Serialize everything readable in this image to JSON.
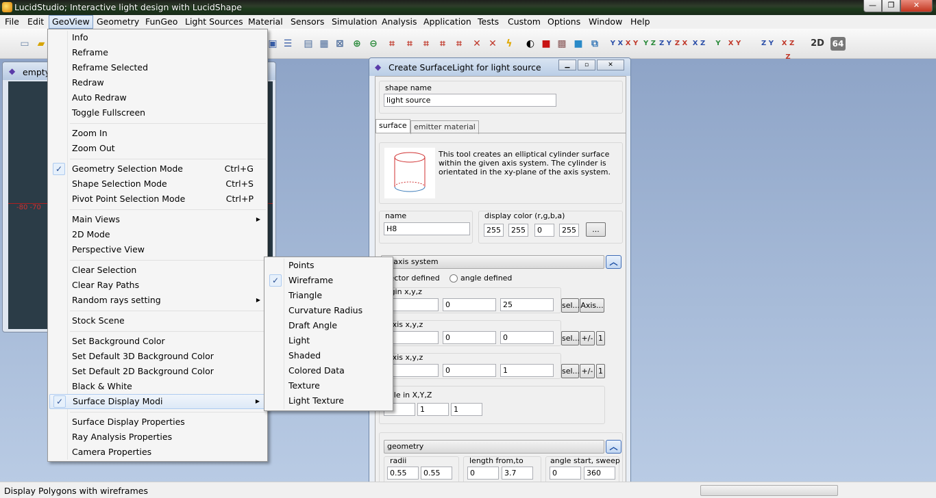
{
  "window": {
    "title": "LucidStudio; Interactive light design with LucidShape",
    "minimize": "—",
    "maximize": "❐",
    "close": "✕"
  },
  "menubar": [
    "File",
    "Edit",
    "GeoView",
    "Geometry",
    "FunGeo",
    "Light Sources",
    "Material",
    "Sensors",
    "Simulation",
    "Analysis",
    "Application",
    "Tests",
    "Custom",
    "Options",
    "Window",
    "Help"
  ],
  "toolbar": {
    "icons": [
      "new-file-icon",
      "open-folder-icon",
      "fit-view-icon",
      "properties-icon",
      "zoom-in-icon",
      "zoom-out-icon",
      "select-geometry-icon",
      "select-material-icon",
      "select-body-icon",
      "select-ray-icon",
      "delete-icon",
      "clear-icon",
      "lightning-icon",
      "shade-toggle-icon",
      "red-cube-icon",
      "texture-cube-icon",
      "colored-cube-icon",
      "axis-view-icon"
    ],
    "labels_2d": "2D",
    "labels_64": "64",
    "axis_views": [
      "Y X",
      "X Y",
      "Y Z",
      "Z Y",
      "Z X",
      "X Z",
      "Y",
      "X Y",
      "Z Y",
      "X Z Z"
    ]
  },
  "child_window": {
    "title": "empty",
    "tick_labels": "-80  -70"
  },
  "geoview_menu": [
    {
      "label": "Info"
    },
    {
      "label": "Reframe"
    },
    {
      "label": "Reframe Selected"
    },
    {
      "label": "Redraw"
    },
    {
      "label": "Auto Redraw"
    },
    {
      "label": "Toggle Fullscreen"
    },
    {
      "label": "Zoom In"
    },
    {
      "label": "Zoom Out"
    },
    {
      "label": "Geometry Selection Mode",
      "shortcut": "Ctrl+G",
      "checked": true
    },
    {
      "label": "Shape Selection Mode",
      "shortcut": "Ctrl+S"
    },
    {
      "label": "Pivot Point Selection Mode",
      "shortcut": "Ctrl+P"
    },
    {
      "label": "Main Views",
      "submenu": true
    },
    {
      "label": "2D Mode"
    },
    {
      "label": "Perspective View"
    },
    {
      "label": "Clear Selection"
    },
    {
      "label": "Clear Ray Paths"
    },
    {
      "label": "Random rays setting",
      "submenu": true
    },
    {
      "label": "Stock Scene"
    },
    {
      "label": "Set Background Color"
    },
    {
      "label": "Set Default 3D Background Color"
    },
    {
      "label": "Set Default 2D Background Color"
    },
    {
      "label": "Black & White"
    },
    {
      "label": "Surface Display Modi",
      "submenu": true,
      "checked": true,
      "highlighted": true
    },
    {
      "label": "Surface Display Properties"
    },
    {
      "label": "Ray Analysis Properties"
    },
    {
      "label": "Camera Properties"
    }
  ],
  "surface_submenu": [
    {
      "label": "Points"
    },
    {
      "label": "Wireframe",
      "checked": true
    },
    {
      "label": "Triangle"
    },
    {
      "label": "Curvature Radius"
    },
    {
      "label": "Draft Angle"
    },
    {
      "label": "Light"
    },
    {
      "label": "Shaded"
    },
    {
      "label": "Colored Data"
    },
    {
      "label": "Texture"
    },
    {
      "label": "Light Texture"
    }
  ],
  "dialog": {
    "title": "Create SurfaceLight for light source",
    "shape_name_label": "shape name",
    "shape_name_value": "light source",
    "tabs": [
      "surface",
      "emitter material"
    ],
    "description": "This tool creates an elliptical cylinder surface within the given axis system. The cylinder is orientated in the xy-plane of the axis system.",
    "name_label": "name",
    "name_value": "H8",
    "color_label": "display color (r,g,b,a)",
    "color_values": [
      "255",
      "255",
      "0",
      "255"
    ],
    "color_button": "...",
    "axis_section": "al axis system",
    "radio_vector": "vector defined",
    "radio_angle": "angle defined",
    "origin_label": "rigin x,y,z",
    "origin_values": [
      "",
      "0",
      "25"
    ],
    "xaxis_label": "-axis x,y,z",
    "xaxis_values": [
      "",
      "0",
      "0"
    ],
    "yaxis_label": "-axis x,y,z",
    "yaxis_values": [
      "",
      "0",
      "1"
    ],
    "sel_button": "sel...",
    "axis_button": "Axis...",
    "pm_button": "+/-",
    "one_button": "1",
    "scale_label": "cale in X,Y,Z",
    "scale_values": [
      "",
      "1",
      "1"
    ],
    "geometry_section": "geometry",
    "radii_label": "radii",
    "radii_values": [
      "0.55",
      "0.55"
    ],
    "length_label": "length from,to",
    "length_values": [
      "0",
      "3.7"
    ],
    "angle_label": "angle start, sweep",
    "angle_values": [
      "0",
      "360"
    ]
  },
  "status": {
    "text": "Display Polygons with wireframes"
  }
}
